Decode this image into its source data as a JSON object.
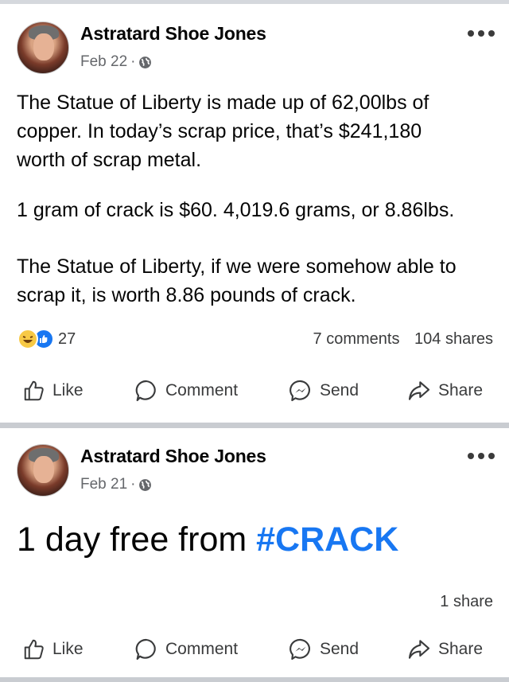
{
  "posts": [
    {
      "author": "Astratard Shoe Jones",
      "date": "Feb 22",
      "separator": "·",
      "privacy_icon": "globe-icon",
      "paragraphs": [
        [
          "The Statue of Liberty is made up of 62,00lbs of",
          "copper. In today’s scrap price, that’s $241,180",
          "worth of scrap metal."
        ],
        [
          "1 gram of crack is $60. 4,019.6 grams, or 8.86lbs."
        ],
        [
          "The Statue of Liberty, if we were somehow able to",
          "scrap it, is worth 8.86 pounds of crack."
        ]
      ],
      "reactions": {
        "icons": [
          "haha-icon",
          "like-icon"
        ],
        "count": "27"
      },
      "comments": "7 comments",
      "shares": "104 shares",
      "actions": {
        "like": "Like",
        "comment": "Comment",
        "send": "Send",
        "share": "Share"
      }
    },
    {
      "author": "Astratard Shoe Jones",
      "date": "Feb 21",
      "separator": "·",
      "privacy_icon": "globe-icon",
      "text_prefix": "1 day free from ",
      "hashtag": "#CRACK",
      "shares": "1 share",
      "actions": {
        "like": "Like",
        "comment": "Comment",
        "send": "Send",
        "share": "Share"
      }
    }
  ],
  "colors": {
    "hashtag": "#1877f2",
    "secondary_text": "#65676b",
    "divider": "#c9ccd1"
  }
}
